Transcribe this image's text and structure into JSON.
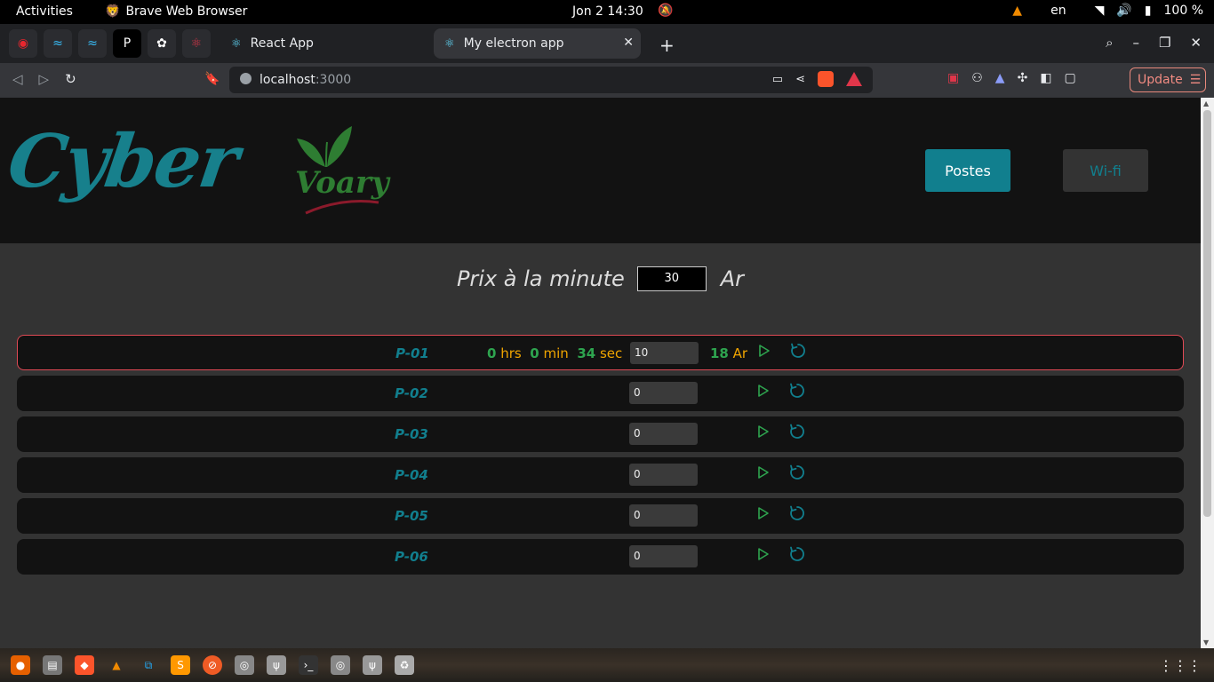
{
  "system_bar": {
    "activities": "Activities",
    "app_name": "Brave Web Browser",
    "clock": "Jon 2  14:30",
    "language": "en",
    "battery": "100 %"
  },
  "browser": {
    "tabs": [
      {
        "label": "React App",
        "active": false
      },
      {
        "label": "My electron app",
        "active": true
      }
    ],
    "url_host": "localhost",
    "url_port": ":3000",
    "update_label": "Update",
    "pinned_tabs": [
      "brave-swirl-icon",
      "tailwind-icon",
      "tailwind-icon",
      "p-icon",
      "openai-icon",
      "react-icon"
    ]
  },
  "app": {
    "logo_text": "Cyber",
    "logo_secondary_text": "Voary",
    "nav": {
      "postes": "Postes",
      "wifi": "Wi-fi"
    },
    "price": {
      "label": "Prix à la minute",
      "value": "30",
      "unit": "Ar"
    },
    "stations": [
      {
        "name": "P-01",
        "active": true,
        "hrs": "0",
        "hrs_label": "hrs",
        "min": "0",
        "min_label": "min",
        "sec": "34",
        "sec_label": "sec",
        "minutes": "10",
        "cost": "18",
        "cost_unit": "Ar"
      },
      {
        "name": "P-02",
        "active": false,
        "minutes": "0"
      },
      {
        "name": "P-03",
        "active": false,
        "minutes": "0"
      },
      {
        "name": "P-04",
        "active": false,
        "minutes": "0"
      },
      {
        "name": "P-05",
        "active": false,
        "minutes": "0"
      },
      {
        "name": "P-06",
        "active": false,
        "minutes": "0"
      }
    ]
  },
  "colors": {
    "accent": "#117f8e",
    "active_border": "#e04a55",
    "green": "#2ea44f",
    "orange": "#f0a500"
  }
}
